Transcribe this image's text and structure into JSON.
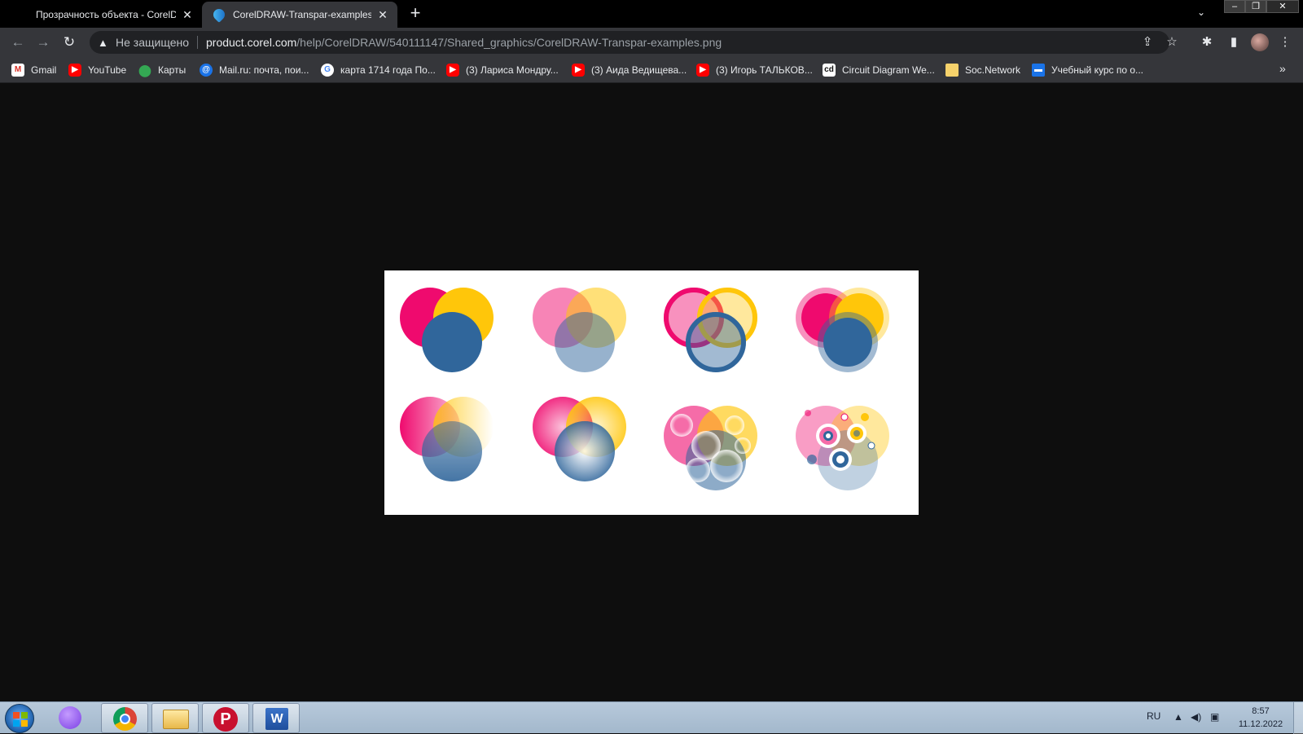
{
  "browser": {
    "tabs": [
      {
        "title": "Прозрачность объекта - CorelD",
        "active": false
      },
      {
        "title": "CorelDRAW-Transpar-examples.p",
        "active": true
      }
    ],
    "newtab_icon": "plus-icon",
    "window_controls": {
      "minimize": "–",
      "restore": "❐",
      "close": "✕"
    },
    "address": {
      "security_label": "Не защищено",
      "url_host": "product.corel.com",
      "url_path": "/help/CorelDRAW/540111147/Shared_graphics/CorelDRAW-Transpar-examples.png"
    },
    "bookmarks": [
      {
        "label": "Gmail",
        "icon": "gmail-icon"
      },
      {
        "label": "YouTube",
        "icon": "youtube-icon"
      },
      {
        "label": "Карты",
        "icon": "maps-icon"
      },
      {
        "label": "Mail.ru: почта, пои...",
        "icon": "mailru-icon"
      },
      {
        "label": "карта 1714 года По...",
        "icon": "google-icon"
      },
      {
        "label": "(3) Лариса Мондру...",
        "icon": "youtube-icon"
      },
      {
        "label": "(3) Аида Ведищева...",
        "icon": "youtube-icon"
      },
      {
        "label": "(3) Игорь ТАЛЬКОВ...",
        "icon": "youtube-icon"
      },
      {
        "label": "Circuit Diagram We...",
        "icon": "circuit-icon"
      },
      {
        "label": "Soc.Network",
        "icon": "folder-icon"
      },
      {
        "label": "Учебный курс по о...",
        "icon": "course-icon"
      }
    ]
  },
  "image": {
    "examples": [
      {
        "style": "uniform-solid"
      },
      {
        "style": "uniform-transparent"
      },
      {
        "style": "outline-rings"
      },
      {
        "style": "outlined-fills"
      },
      {
        "style": "linear-fade"
      },
      {
        "style": "radial-gradient"
      },
      {
        "style": "texture-bubbles"
      },
      {
        "style": "pattern-dots"
      }
    ],
    "colors": {
      "magenta": "#ef0a6e",
      "yellow": "#ffc60a",
      "blue": "#30669b"
    }
  },
  "taskbar": {
    "apps": [
      "alice-icon",
      "chrome-icon",
      "explorer-icon",
      "p-app-icon",
      "word-icon"
    ],
    "word_glyph": "W",
    "p_glyph": "P",
    "language": "RU",
    "time": "8:57",
    "date": "11.12.2022"
  }
}
